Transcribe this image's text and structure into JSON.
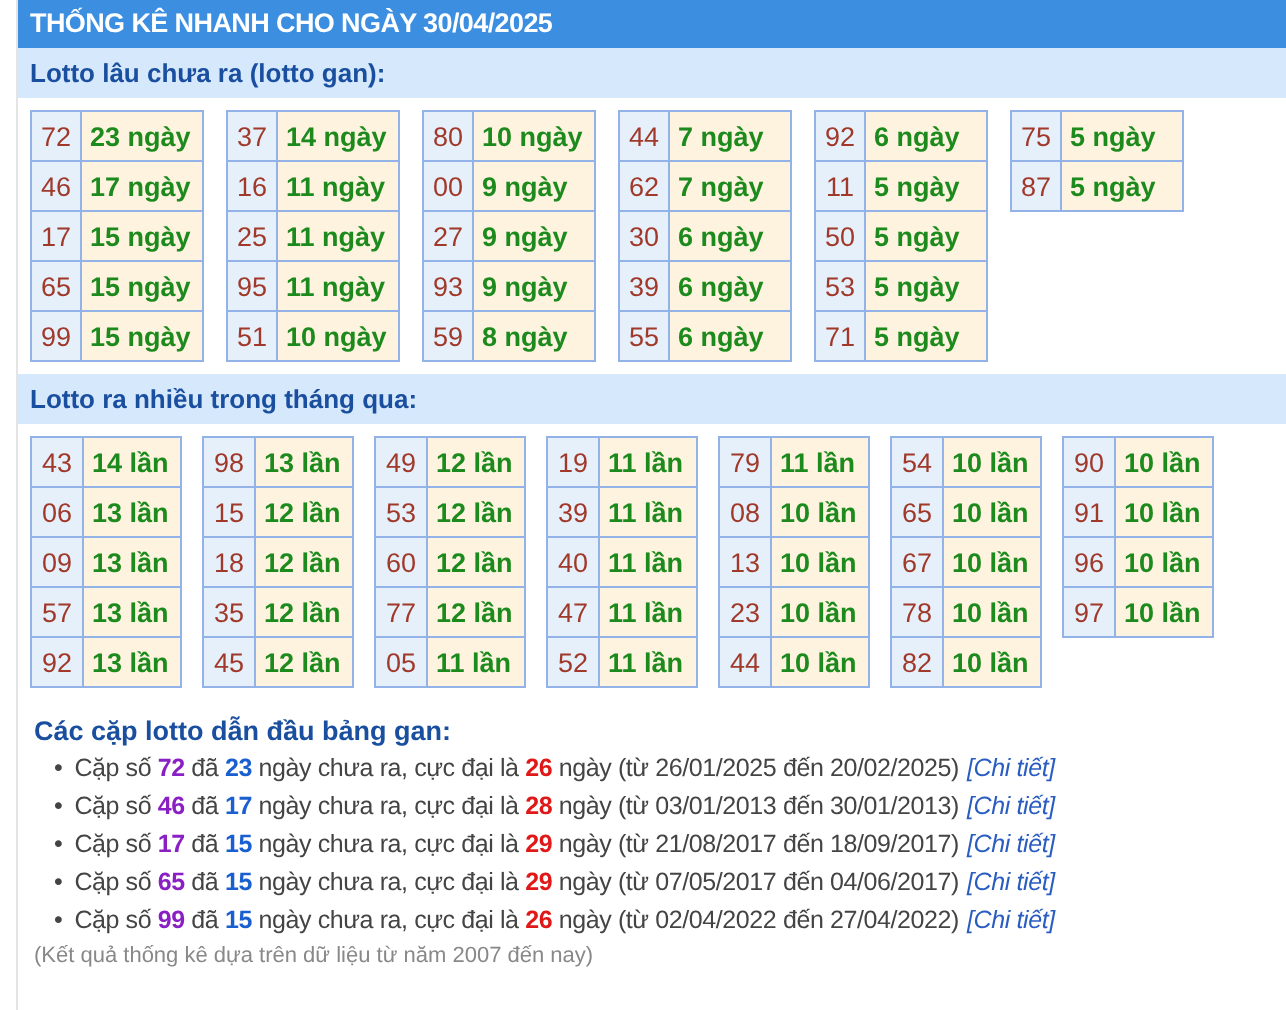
{
  "title": "THỐNG KÊ NHANH CHO NGÀY 30/04/2025",
  "sections": [
    {
      "heading": "Lotto lâu chưa ra (lotto gan):",
      "groups": [
        {
          "rows": [
            {
              "number": "72",
              "count": "23 ngày"
            },
            {
              "number": "46",
              "count": "17 ngày"
            },
            {
              "number": "17",
              "count": "15 ngày"
            },
            {
              "number": "65",
              "count": "15 ngày"
            },
            {
              "number": "99",
              "count": "15 ngày"
            }
          ]
        },
        {
          "rows": [
            {
              "number": "37",
              "count": "14 ngày"
            },
            {
              "number": "16",
              "count": "11 ngày"
            },
            {
              "number": "25",
              "count": "11 ngày"
            },
            {
              "number": "95",
              "count": "11 ngày"
            },
            {
              "number": "51",
              "count": "10 ngày"
            }
          ]
        },
        {
          "rows": [
            {
              "number": "80",
              "count": "10 ngày"
            },
            {
              "number": "00",
              "count": "9 ngày"
            },
            {
              "number": "27",
              "count": "9 ngày"
            },
            {
              "number": "93",
              "count": "9 ngày"
            },
            {
              "number": "59",
              "count": "8 ngày"
            }
          ]
        },
        {
          "rows": [
            {
              "number": "44",
              "count": "7 ngày"
            },
            {
              "number": "62",
              "count": "7 ngày"
            },
            {
              "number": "30",
              "count": "6 ngày"
            },
            {
              "number": "39",
              "count": "6 ngày"
            },
            {
              "number": "55",
              "count": "6 ngày"
            }
          ]
        },
        {
          "rows": [
            {
              "number": "92",
              "count": "6 ngày"
            },
            {
              "number": "11",
              "count": "5 ngày"
            },
            {
              "number": "50",
              "count": "5 ngày"
            },
            {
              "number": "53",
              "count": "5 ngày"
            },
            {
              "number": "71",
              "count": "5 ngày"
            }
          ]
        },
        {
          "rows": [
            {
              "number": "75",
              "count": "5 ngày"
            },
            {
              "number": "87",
              "count": "5 ngày"
            }
          ]
        }
      ]
    },
    {
      "heading": "Lotto ra nhiều trong tháng qua:",
      "groups": [
        {
          "rows": [
            {
              "number": "43",
              "count": "14 lần"
            },
            {
              "number": "06",
              "count": "13 lần"
            },
            {
              "number": "09",
              "count": "13 lần"
            },
            {
              "number": "57",
              "count": "13 lần"
            },
            {
              "number": "92",
              "count": "13 lần"
            }
          ]
        },
        {
          "rows": [
            {
              "number": "98",
              "count": "13 lần"
            },
            {
              "number": "15",
              "count": "12 lần"
            },
            {
              "number": "18",
              "count": "12 lần"
            },
            {
              "number": "35",
              "count": "12 lần"
            },
            {
              "number": "45",
              "count": "12 lần"
            }
          ]
        },
        {
          "rows": [
            {
              "number": "49",
              "count": "12 lần"
            },
            {
              "number": "53",
              "count": "12 lần"
            },
            {
              "number": "60",
              "count": "12 lần"
            },
            {
              "number": "77",
              "count": "12 lần"
            },
            {
              "number": "05",
              "count": "11 lần"
            }
          ]
        },
        {
          "rows": [
            {
              "number": "19",
              "count": "11 lần"
            },
            {
              "number": "39",
              "count": "11 lần"
            },
            {
              "number": "40",
              "count": "11 lần"
            },
            {
              "number": "47",
              "count": "11 lần"
            },
            {
              "number": "52",
              "count": "11 lần"
            }
          ]
        },
        {
          "rows": [
            {
              "number": "79",
              "count": "11 lần"
            },
            {
              "number": "08",
              "count": "10 lần"
            },
            {
              "number": "13",
              "count": "10 lần"
            },
            {
              "number": "23",
              "count": "10 lần"
            },
            {
              "number": "44",
              "count": "10 lần"
            }
          ]
        },
        {
          "rows": [
            {
              "number": "54",
              "count": "10 lần"
            },
            {
              "number": "65",
              "count": "10 lần"
            },
            {
              "number": "67",
              "count": "10 lần"
            },
            {
              "number": "78",
              "count": "10 lần"
            },
            {
              "number": "82",
              "count": "10 lần"
            }
          ]
        },
        {
          "rows": [
            {
              "number": "90",
              "count": "10 lần"
            },
            {
              "number": "91",
              "count": "10 lần"
            },
            {
              "number": "96",
              "count": "10 lần"
            },
            {
              "number": "97",
              "count": "10 lần"
            }
          ]
        }
      ]
    }
  ],
  "leaders": {
    "heading": "Các cặp lotto dẫn đầu bảng gan:",
    "items": [
      {
        "bullet": "•",
        "parts": [
          {
            "kind": "plain",
            "text": "Cặp số "
          },
          {
            "kind": "pair",
            "text": "72"
          },
          {
            "kind": "plain",
            "text": " đã "
          },
          {
            "kind": "days",
            "text": "23"
          },
          {
            "kind": "plain",
            "text": " ngày chưa ra, cực đại là "
          },
          {
            "kind": "max",
            "text": "26"
          },
          {
            "kind": "plain",
            "text": " ngày (từ 26/01/2025 đến 20/02/2025)"
          }
        ],
        "link": "[Chi tiết]"
      },
      {
        "bullet": "•",
        "parts": [
          {
            "kind": "plain",
            "text": "Cặp số "
          },
          {
            "kind": "pair",
            "text": "46"
          },
          {
            "kind": "plain",
            "text": " đã "
          },
          {
            "kind": "days",
            "text": "17"
          },
          {
            "kind": "plain",
            "text": " ngày chưa ra, cực đại là "
          },
          {
            "kind": "max",
            "text": "28"
          },
          {
            "kind": "plain",
            "text": " ngày (từ 03/01/2013 đến 30/01/2013)"
          }
        ],
        "link": "[Chi tiết]"
      },
      {
        "bullet": "•",
        "parts": [
          {
            "kind": "plain",
            "text": "Cặp số "
          },
          {
            "kind": "pair",
            "text": "17"
          },
          {
            "kind": "plain",
            "text": " đã "
          },
          {
            "kind": "days",
            "text": "15"
          },
          {
            "kind": "plain",
            "text": " ngày chưa ra, cực đại là "
          },
          {
            "kind": "max",
            "text": "29"
          },
          {
            "kind": "plain",
            "text": " ngày (từ 21/08/2017 đến 18/09/2017)"
          }
        ],
        "link": "[Chi tiết]"
      },
      {
        "bullet": "•",
        "parts": [
          {
            "kind": "plain",
            "text": "Cặp số "
          },
          {
            "kind": "pair",
            "text": "65"
          },
          {
            "kind": "plain",
            "text": " đã "
          },
          {
            "kind": "days",
            "text": "15"
          },
          {
            "kind": "plain",
            "text": " ngày chưa ra, cực đại là "
          },
          {
            "kind": "max",
            "text": "29"
          },
          {
            "kind": "plain",
            "text": " ngày (từ 07/05/2017 đến 04/06/2017)"
          }
        ],
        "link": "[Chi tiết]"
      },
      {
        "bullet": "•",
        "parts": [
          {
            "kind": "plain",
            "text": "Cặp số "
          },
          {
            "kind": "pair",
            "text": "99"
          },
          {
            "kind": "plain",
            "text": " đã "
          },
          {
            "kind": "days",
            "text": "15"
          },
          {
            "kind": "plain",
            "text": " ngày chưa ra, cực đại là "
          },
          {
            "kind": "max",
            "text": "26"
          },
          {
            "kind": "plain",
            "text": " ngày (từ 02/04/2022 đến 27/04/2022)"
          }
        ],
        "link": "[Chi tiết]"
      }
    ],
    "note": "(Kết quả thống kê dựa trên dữ liệu từ năm 2007 đến nay)"
  }
}
